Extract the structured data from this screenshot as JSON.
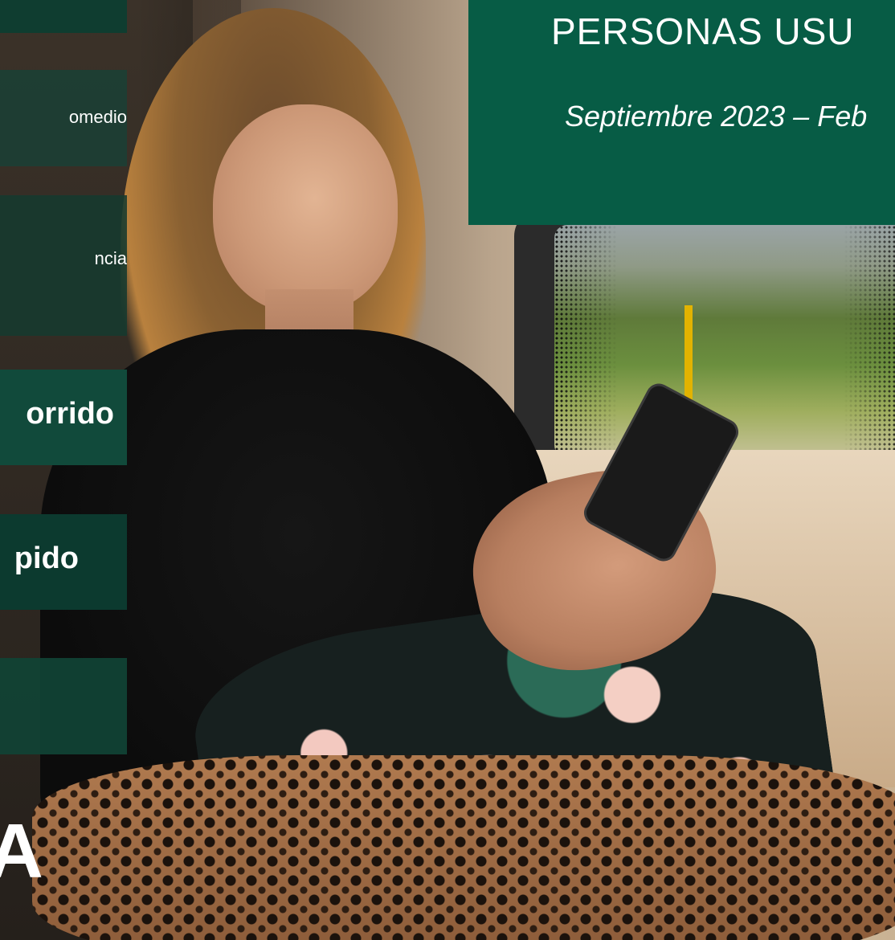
{
  "header": {
    "title": "PERSONAS USU",
    "subtitle": "Septiembre 2023 – Feb"
  },
  "sidebar": {
    "items": [
      {
        "label": ""
      },
      {
        "label": "omedio"
      },
      {
        "label": "ncia"
      },
      {
        "label": "orrido"
      },
      {
        "label": "pido"
      },
      {
        "label": ""
      }
    ],
    "large_letter": "A"
  },
  "colors": {
    "header_bg": "#075c45",
    "tile_bg": "#114a3b",
    "text": "#ffffff"
  }
}
